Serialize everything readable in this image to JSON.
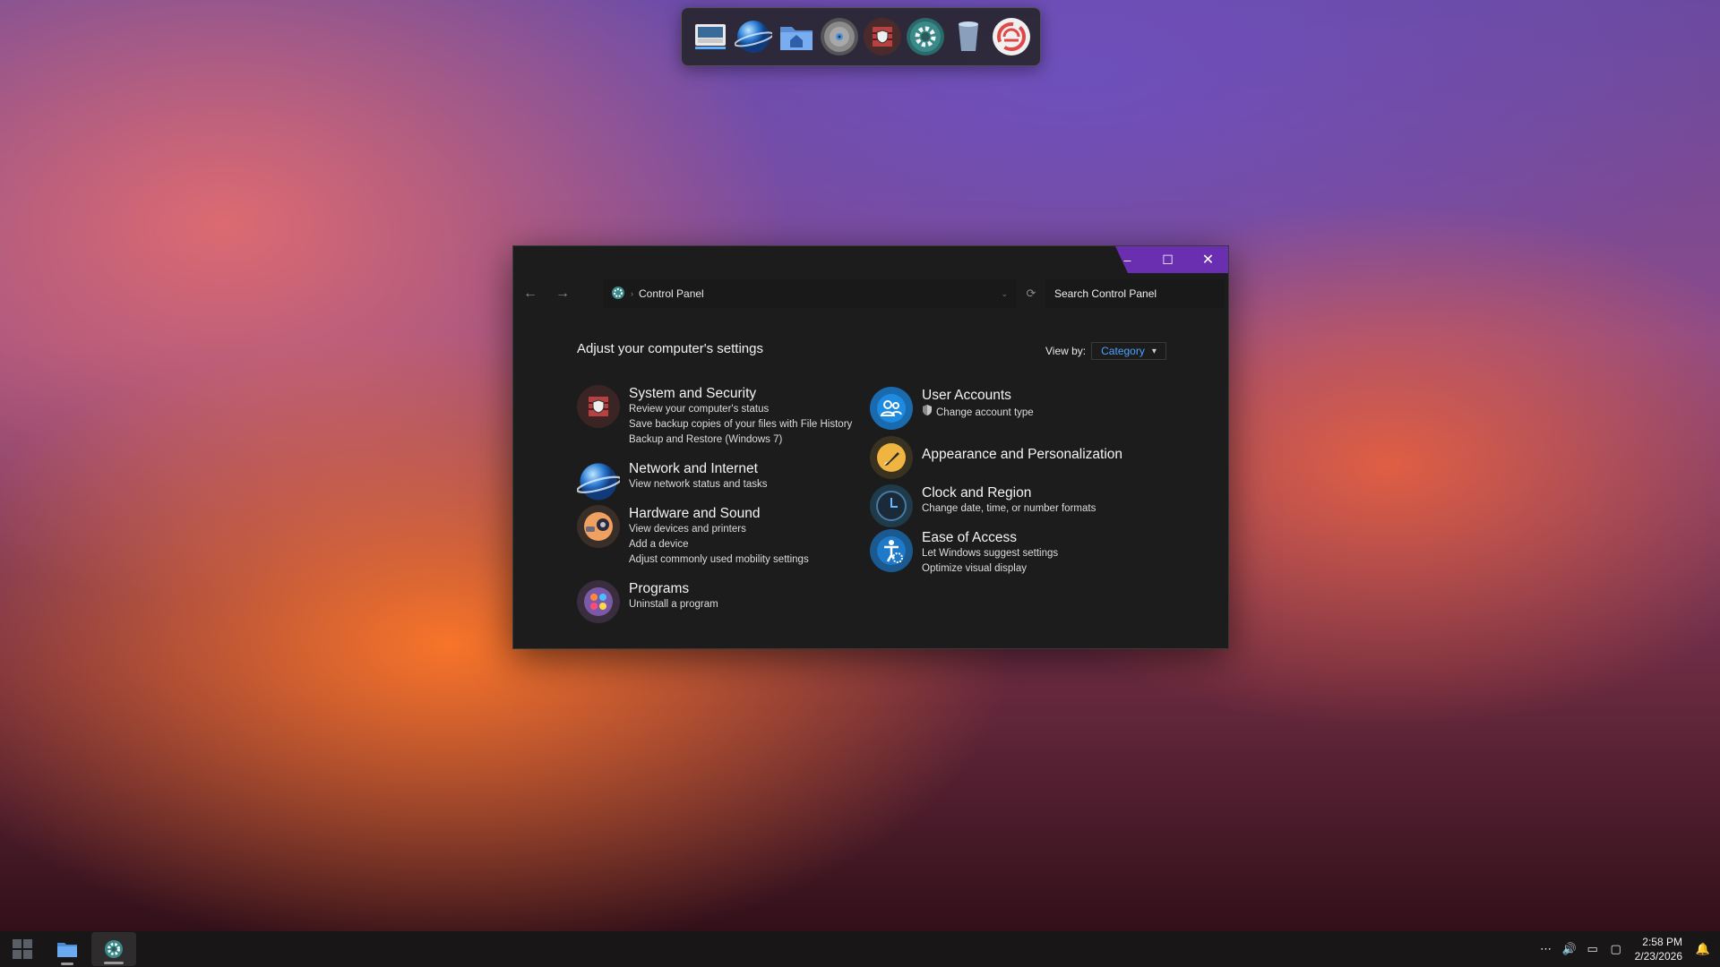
{
  "dock": {
    "items": [
      "monitor-icon",
      "network-globe-icon",
      "home-folder-icon",
      "disc-icon",
      "security-shield-icon",
      "control-panel-gear-icon",
      "recycle-bin-icon",
      "sync-app-icon"
    ]
  },
  "window": {
    "controls": {
      "minimize": "–",
      "maximize": "☐",
      "close": "✕"
    },
    "nav": {
      "back": "←",
      "forward": "→",
      "refresh": "⟳",
      "dropdown": "⌄"
    },
    "address": {
      "separator": "›",
      "current": "Control Panel"
    },
    "search": {
      "placeholder": "Search Control Panel"
    },
    "heading": "Adjust your computer's settings",
    "view_by": {
      "label": "View by:",
      "value": "Category",
      "arrow": "▾"
    },
    "categories": {
      "system_security": {
        "title": "System and Security",
        "links": [
          "Review your computer's status",
          "Save backup copies of your files with File History",
          "Backup and Restore (Windows 7)"
        ]
      },
      "network": {
        "title": "Network and Internet",
        "links": [
          "View network status and tasks"
        ]
      },
      "hardware": {
        "title": "Hardware and Sound",
        "links": [
          "View devices and printers",
          "Add a device",
          "Adjust commonly used mobility settings"
        ]
      },
      "programs": {
        "title": "Programs",
        "links": [
          "Uninstall a program"
        ]
      },
      "user_accounts": {
        "title": "User Accounts",
        "links": [
          "Change account type"
        ]
      },
      "appearance": {
        "title": "Appearance and Personalization",
        "links": []
      },
      "clock": {
        "title": "Clock and Region",
        "links": [
          "Change date, time, or number formats"
        ]
      },
      "ease": {
        "title": "Ease of Access",
        "links": [
          "Let Windows suggest settings",
          "Optimize visual display"
        ]
      }
    }
  },
  "taskbar": {
    "tray": {
      "overflow": "⋯",
      "volume": "🔊",
      "battery": "▭",
      "display": "▢",
      "notifications": "🔔"
    },
    "time": "2:58 PM",
    "date": "2/23/2026"
  },
  "colors": {
    "accent": "#6a2fb0",
    "link": "#4aa3ff",
    "window_bg": "#1c1c1c"
  }
}
